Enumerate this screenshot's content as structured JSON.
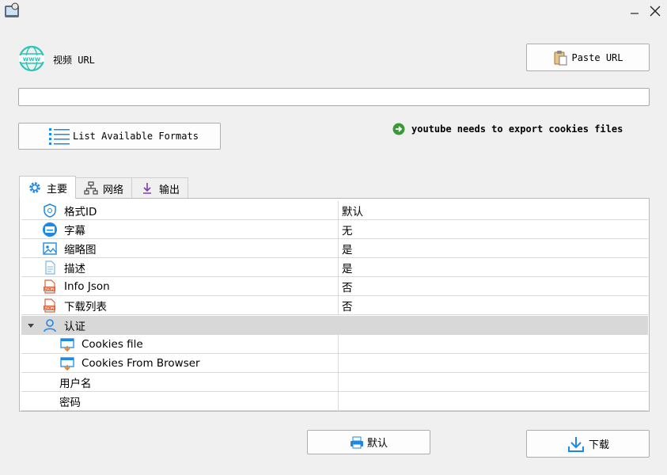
{
  "window": {
    "icon": "app-icon",
    "controls": [
      "minimize-icon",
      "close-icon"
    ]
  },
  "url_section": {
    "label": "视频 URL",
    "paste_button": "Paste URL",
    "url_value": "",
    "list_formats_button": "List Available Formats",
    "notice": "youtube needs to export cookies files"
  },
  "tabs": [
    {
      "label": "主要",
      "icon": "gear-icon",
      "active": true
    },
    {
      "label": "网络",
      "icon": "network-icon",
      "active": false
    },
    {
      "label": "输出",
      "icon": "output-icon",
      "active": false
    }
  ],
  "properties": [
    {
      "name": "格式ID",
      "value": "默认",
      "icon": "shield-icon"
    },
    {
      "name": "字幕",
      "value": "无",
      "icon": "subtitle-icon"
    },
    {
      "name": "缩略图",
      "value": "是",
      "icon": "image-icon"
    },
    {
      "name": "描述",
      "value": "是",
      "icon": "document-icon"
    },
    {
      "name": "Info Json",
      "value": "否",
      "icon": "json-icon"
    },
    {
      "name": "下载列表",
      "value": "否",
      "icon": "json-icon"
    }
  ],
  "auth_group": {
    "label": "认证",
    "icon": "user-icon",
    "expanded": true,
    "items": [
      {
        "name": "Cookies file",
        "value": "",
        "icon": "cookie-file-icon"
      },
      {
        "name": "Cookies From Browser",
        "value": "",
        "icon": "cookie-browser-icon"
      },
      {
        "name": "用户名",
        "value": ""
      },
      {
        "name": "密码",
        "value": ""
      }
    ]
  },
  "buttons": {
    "default": "默认",
    "download": "下载"
  },
  "colors": {
    "accent": "#1e88e5",
    "notice_green": "#3a9a3a",
    "group_row": "#d8d8d8"
  }
}
